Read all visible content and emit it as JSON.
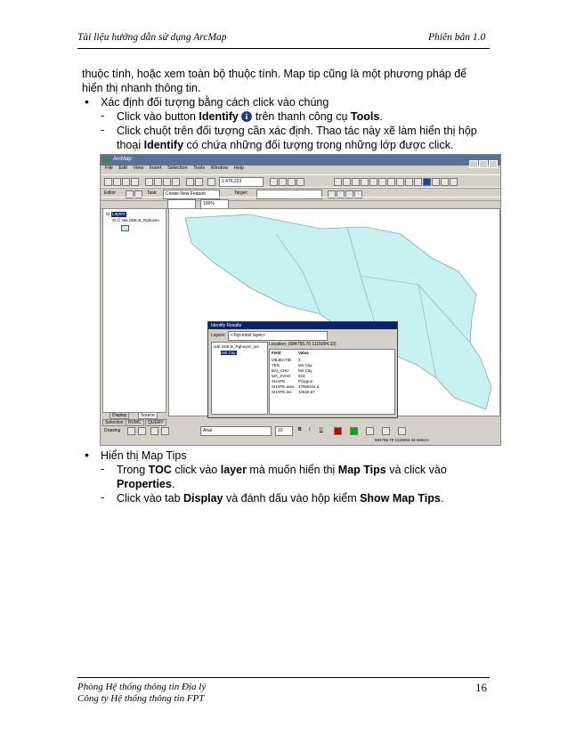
{
  "header": {
    "left": "Tài liệu hướng dẫn sử dụng ArcMap",
    "right": "Phiên bản 1.0"
  },
  "para1": {
    "line1": "thuộc tính, hoặc xem toàn bộ thuộc tính. Map tip cũng là một phương pháp để",
    "line2": "hiển thị nhanh thông tin."
  },
  "bullet1": {
    "text": "Xác định đối tượng bằng cách click vào chúng",
    "sub1_a": "Click vào button ",
    "sub1_b": "Identify",
    "sub1_c": " trên thanh công cụ ",
    "sub1_d": "Tools",
    "sub1_e": ".",
    "sub2_line1": "Click chuột trên đối tượng cần xác định. Thao tác này xẽ làm hiển thị hộp",
    "sub2_a": "thoại ",
    "sub2_b": "Identify",
    "sub2_c": " có chứa những đối tượng trong những lớp được click."
  },
  "screenshot": {
    "menu": [
      "File",
      "Edit",
      "View",
      "Insert",
      "Selection",
      "Tools",
      "Window",
      "Help"
    ],
    "scale": "1:476,223",
    "editor": "Editor",
    "task": "Create New Feature",
    "target": "Target:",
    "layers_label": "Layers",
    "layer_name": "sde.SDE.B_Rghuyen",
    "tab_display": "Display",
    "tab_source": "Source",
    "tab_selection": "Selection",
    "tab_rvmc": "RVMC",
    "tab_query": "QUERY",
    "drawing": "Drawing",
    "font": "Arial",
    "fontsize": "10",
    "status": "584755.70  1115094.33 Meters",
    "identify": {
      "title": "Identify Results",
      "layers_lbl": "Layers:",
      "layers_val": "<Top-most layer>",
      "tree_root": "sde.SDE.B_Rghuyen_arc",
      "tree_child": "Mỏ Cày",
      "location": "Location: (584755.70  1115094.33)",
      "col_field": "Field",
      "col_value": "Value",
      "fields": [
        "OBJECTID",
        "TEN",
        "BAI_CHU",
        "MA_XVHC",
        "SHAPE",
        "SHAPE.area",
        "SHAPE.len"
      ],
      "values": [
        "3",
        "Mỏ Cày",
        "Mỏ Cày",
        "833",
        "Polygon",
        "37656211.6",
        "10628.67"
      ]
    }
  },
  "bullet2": {
    "text": "Hiển thị Map Tips",
    "sub1_a": "Trong ",
    "sub1_b": "TOC",
    "sub1_c": " click vào ",
    "sub1_d": "layer",
    "sub1_e": " mà muốn hiển thị ",
    "sub1_f": "Map Tips",
    "sub1_g": " và click vào",
    "sub1_line2": "Properties",
    "sub1_line2_end": ".",
    "sub2_a": "Click vào tab ",
    "sub2_b": "Display",
    "sub2_c": " và đánh dấu vào hộp kiểm ",
    "sub2_d": "Show Map Tips",
    "sub2_e": "."
  },
  "footer": {
    "line1": "Phòng Hệ thống thông tin Địa lý",
    "line2": "Công ty Hệ thống thông tin FPT",
    "page": "16"
  },
  "colors": {
    "map_fill": "#c6f1f0",
    "title_bar": "#0a246a"
  },
  "icons": [
    "info-icon"
  ]
}
